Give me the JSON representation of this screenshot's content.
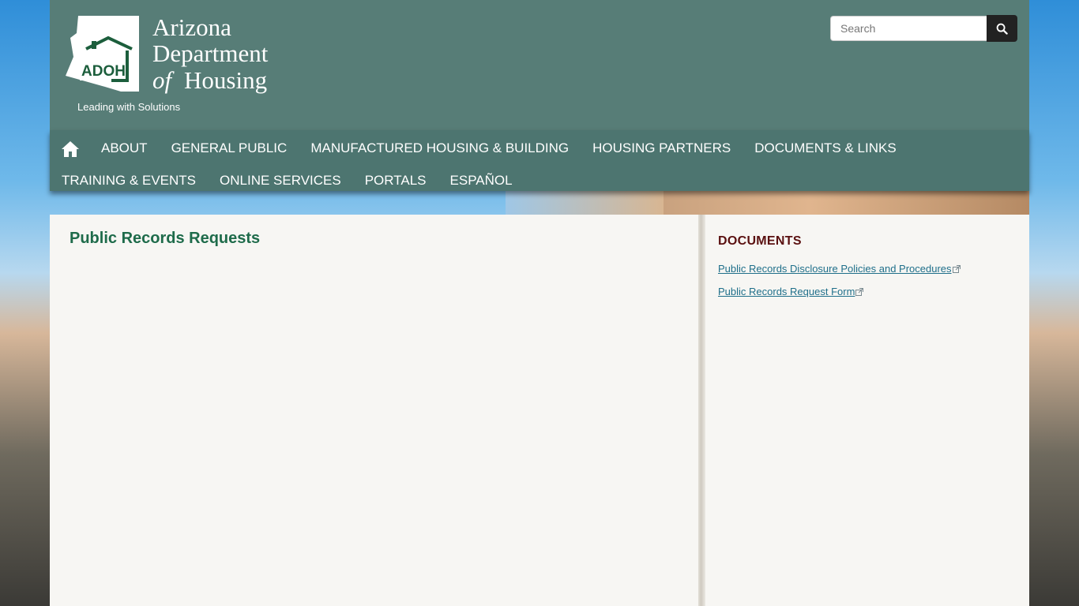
{
  "header": {
    "logo_line1": "Arizona",
    "logo_line2": "Department",
    "logo_line3_of": "of",
    "logo_line3_word": "Housing",
    "logo_badge": "ADOH",
    "tagline": "Leading with Solutions",
    "search_placeholder": "Search"
  },
  "nav": {
    "items": [
      "ABOUT",
      "GENERAL PUBLIC",
      "MANUFACTURED HOUSING & BUILDING",
      "HOUSING PARTNERS",
      "DOCUMENTS & LINKS",
      "TRAINING & EVENTS",
      "ONLINE SERVICES",
      "PORTALS",
      "ESPAÑOL"
    ]
  },
  "main": {
    "title": "Public Records Requests"
  },
  "sidebar": {
    "heading": "DOCUMENTS",
    "links": [
      "Public Records Disclosure Policies and Procedures",
      "Public Records Request Form"
    ]
  },
  "colors": {
    "header_bg": "#577d77",
    "nav_bg": "#4d7570",
    "title_green": "#1e6b4a",
    "heading_maroon": "#5a1010",
    "link": "#1f6f8a",
    "logo_green": "#1c5e3c"
  },
  "icons": {
    "home": "home-icon",
    "search": "search-icon",
    "external": "external-link-icon"
  }
}
